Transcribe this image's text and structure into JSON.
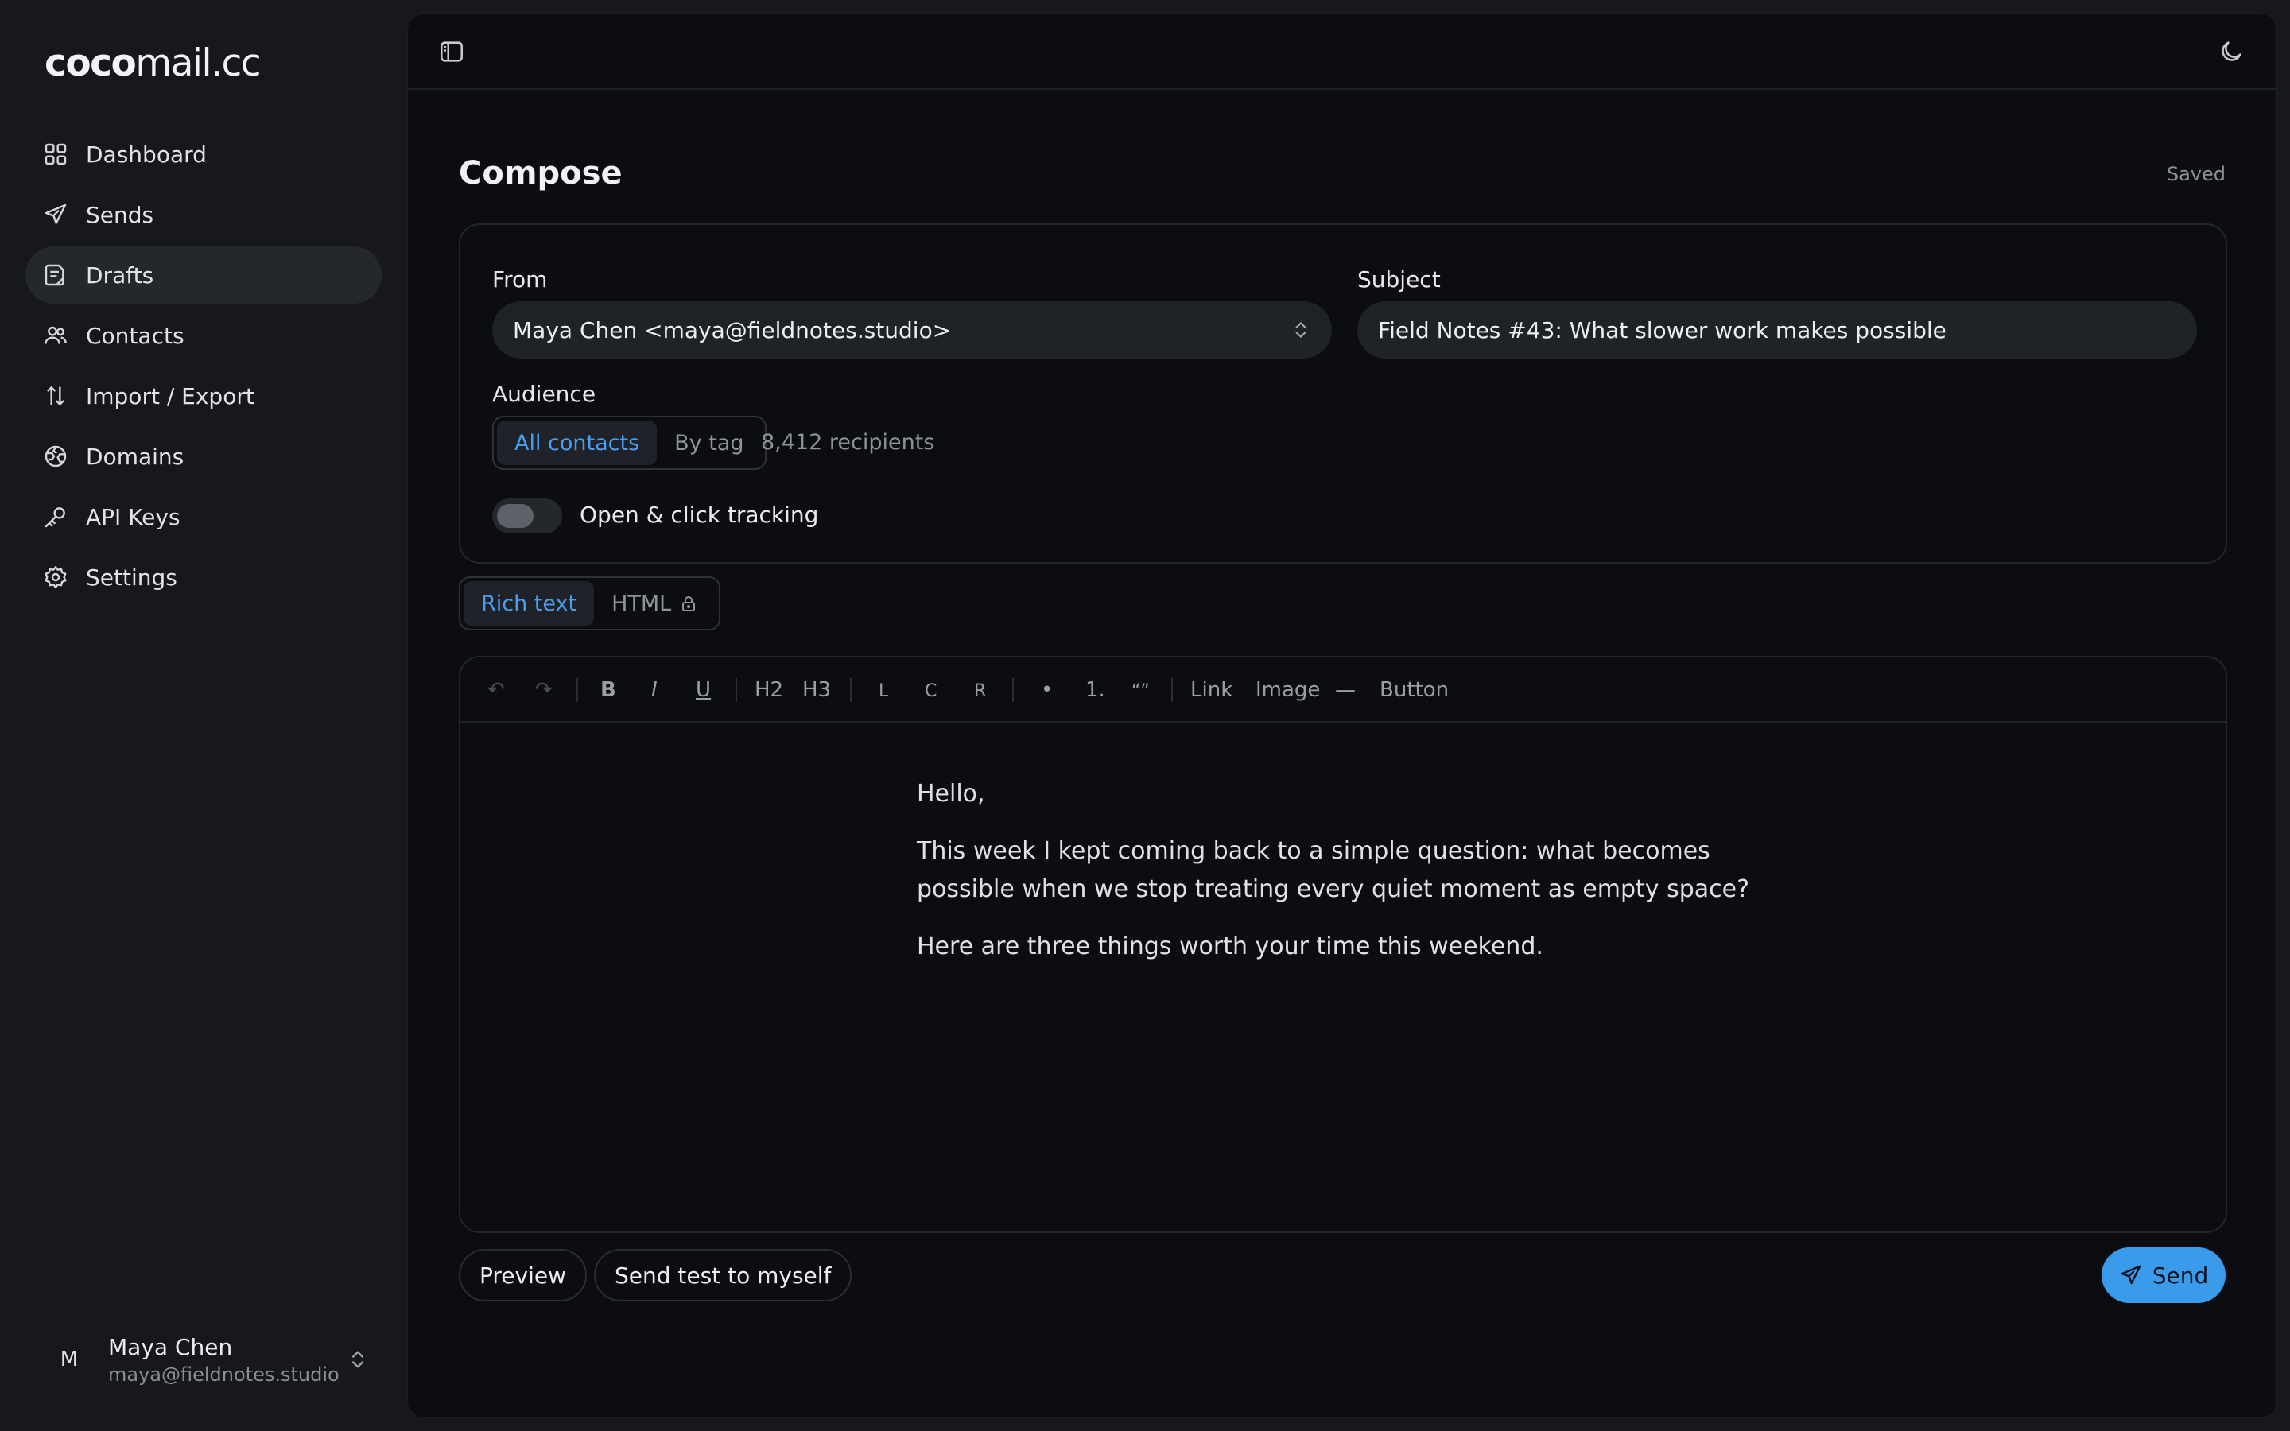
{
  "brand": {
    "bold": "coco",
    "rest": "mail.cc"
  },
  "nav": [
    {
      "label": "Dashboard",
      "icon": "dashboard-icon"
    },
    {
      "label": "Sends",
      "icon": "send-icon"
    },
    {
      "label": "Drafts",
      "icon": "drafts-icon",
      "active": true
    },
    {
      "label": "Contacts",
      "icon": "contacts-icon"
    },
    {
      "label": "Import / Export",
      "icon": "import-export-icon"
    },
    {
      "label": "Domains",
      "icon": "globe-icon"
    },
    {
      "label": "API Keys",
      "icon": "key-icon"
    },
    {
      "label": "Settings",
      "icon": "gear-icon"
    }
  ],
  "user": {
    "initial": "M",
    "name": "Maya Chen",
    "email": "maya@fieldnotes.studio"
  },
  "page": {
    "title": "Compose",
    "status": "Saved"
  },
  "form": {
    "from_label": "From",
    "from_value": "Maya Chen <maya@fieldnotes.studio>",
    "subject_label": "Subject",
    "subject_value": "Field Notes #43: What slower work makes possible",
    "audience_label": "Audience",
    "audience_options": [
      "All contacts",
      "By tag"
    ],
    "audience_selected": "All contacts",
    "recipients": "8,412 recipients",
    "tracking_label": "Open & click tracking",
    "tracking_enabled": false
  },
  "editor": {
    "modes": [
      "Rich text",
      "HTML"
    ],
    "mode_selected": "Rich text",
    "toolbar": {
      "undo": "↶",
      "redo": "↷",
      "bold": "B",
      "italic": "I",
      "underline": "U",
      "h2": "H2",
      "h3": "H3",
      "align_left": "L",
      "align_center": "C",
      "align_right": "R",
      "bullet": "•",
      "ordered": "1.",
      "quote": "“”",
      "link": "Link",
      "image": "Image",
      "divider": "—",
      "button": "Button"
    },
    "body": [
      "Hello,",
      "This week I kept coming back to a simple question: what becomes possible when we stop treating every quiet moment as empty space?",
      "Here are three things worth your time this weekend."
    ]
  },
  "actions": {
    "preview": "Preview",
    "send_test": "Send test to myself",
    "send": "Send"
  },
  "colors": {
    "accent": "#3a9bea",
    "background": "#0b0d10",
    "sidebar": "#16181c"
  }
}
